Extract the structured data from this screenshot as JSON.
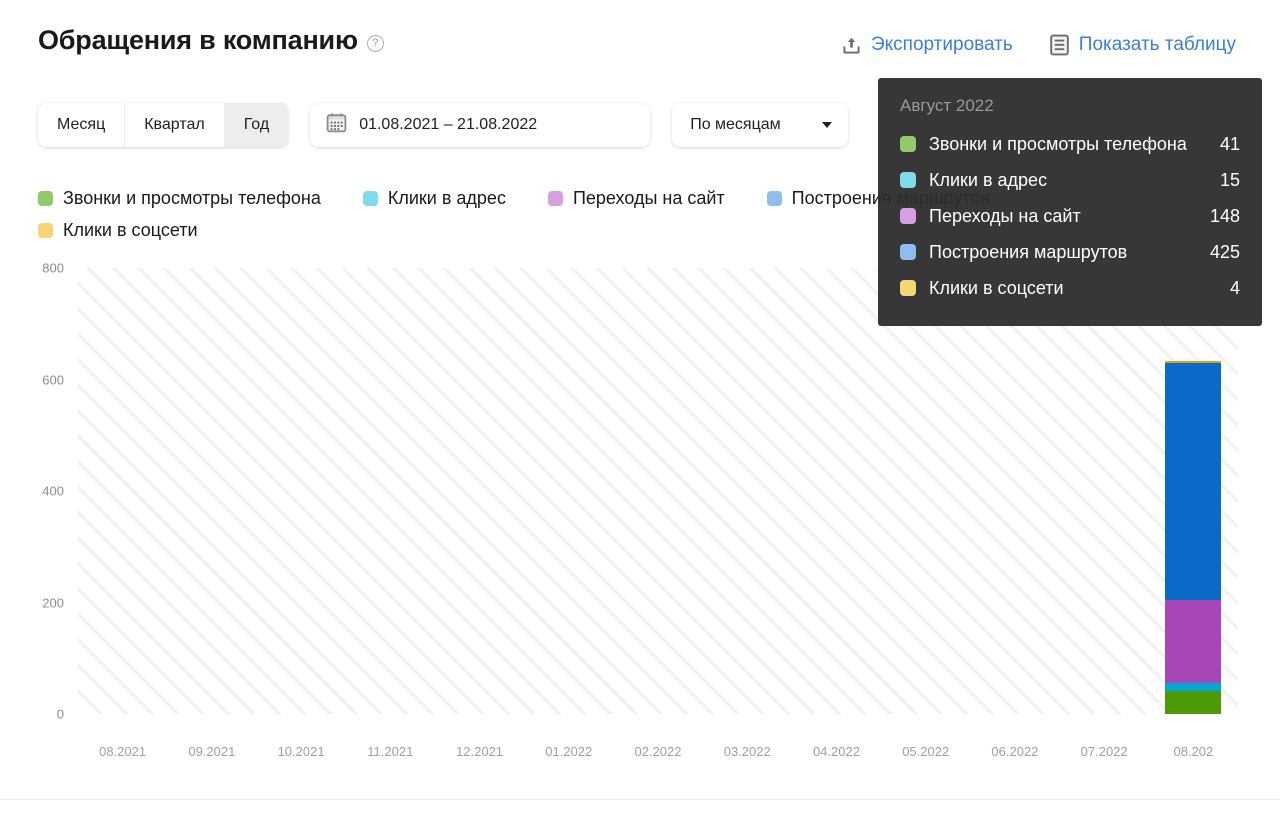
{
  "header": {
    "title": "Обращения в компанию",
    "help_icon": "question-circle-icon",
    "actions": [
      {
        "label": "Экспортировать",
        "icon": "export-upload-icon"
      },
      {
        "label": "Показать таблицу",
        "icon": "table-document-icon"
      }
    ],
    "link_color": "#3d7ddb"
  },
  "controls": {
    "period_tabs": [
      {
        "label": "Месяц",
        "active": false
      },
      {
        "label": "Квартал",
        "active": false
      },
      {
        "label": "Год",
        "active": true
      }
    ],
    "date_range": {
      "icon": "calendar-icon",
      "value": "01.08.2021 – 21.08.2022"
    },
    "grouping": {
      "value": "По месяцам",
      "icon": "chevron-down-icon"
    }
  },
  "legend": [
    {
      "label": "Звонки и просмотры телефона",
      "color": "#92c96b"
    },
    {
      "label": "Клики в адрес",
      "color": "#7fdcea"
    },
    {
      "label": "Переходы на сайт",
      "color": "#d69fe0"
    },
    {
      "label": "Построения маршрутов",
      "color": "#8fbdf0"
    },
    {
      "label": "Клики в соцсети",
      "color": "#f5d576"
    }
  ],
  "tooltip": {
    "title": "Август 2022",
    "rows": [
      {
        "label": "Звонки и просмотры телефона",
        "value": "41",
        "color": "#92c96b"
      },
      {
        "label": "Клики в адрес",
        "value": "15",
        "color": "#7fdcea"
      },
      {
        "label": "Переходы на сайт",
        "value": "148",
        "color": "#d69fe0"
      },
      {
        "label": "Построения маршрутов",
        "value": "425",
        "color": "#8fbdf0"
      },
      {
        "label": "Клики в соцсети",
        "value": "4",
        "color": "#f5d576"
      }
    ]
  },
  "chart_data": {
    "type": "bar",
    "stacked": true,
    "title": "Обращения в компанию",
    "xlabel": "",
    "ylabel": "",
    "ylim": [
      0,
      800
    ],
    "yticks": [
      0,
      200,
      400,
      600,
      800
    ],
    "ytick_labels": [
      "0",
      "200",
      "400",
      "600",
      "800"
    ],
    "grid": false,
    "background_hatch": true,
    "legend_position": "top",
    "categories": [
      "08.2021",
      "09.2021",
      "10.2021",
      "11.2021",
      "12.2021",
      "01.2022",
      "02.2022",
      "03.2022",
      "04.2022",
      "05.2022",
      "06.2022",
      "07.2022",
      "08.202"
    ],
    "series": [
      {
        "name": "Звонки и просмотры телефона",
        "color": "#4e9a06",
        "values": [
          0,
          0,
          0,
          0,
          0,
          0,
          0,
          0,
          0,
          0,
          0,
          0,
          41
        ]
      },
      {
        "name": "Клики в адрес",
        "color": "#00a8d6",
        "values": [
          0,
          0,
          0,
          0,
          0,
          0,
          0,
          0,
          0,
          0,
          0,
          0,
          15
        ]
      },
      {
        "name": "Переходы на сайт",
        "color": "#a845b8",
        "values": [
          0,
          0,
          0,
          0,
          0,
          0,
          0,
          0,
          0,
          0,
          0,
          0,
          148
        ]
      },
      {
        "name": "Построения маршрутов",
        "color": "#0b69c7",
        "values": [
          0,
          0,
          0,
          0,
          0,
          0,
          0,
          0,
          0,
          0,
          0,
          0,
          425
        ]
      },
      {
        "name": "Клики в соцсети",
        "color": "#e0a11a",
        "values": [
          0,
          0,
          0,
          0,
          0,
          0,
          0,
          0,
          0,
          0,
          0,
          0,
          4
        ]
      }
    ],
    "totals": [
      0,
      0,
      0,
      0,
      0,
      0,
      0,
      0,
      0,
      0,
      0,
      0,
      633
    ]
  }
}
